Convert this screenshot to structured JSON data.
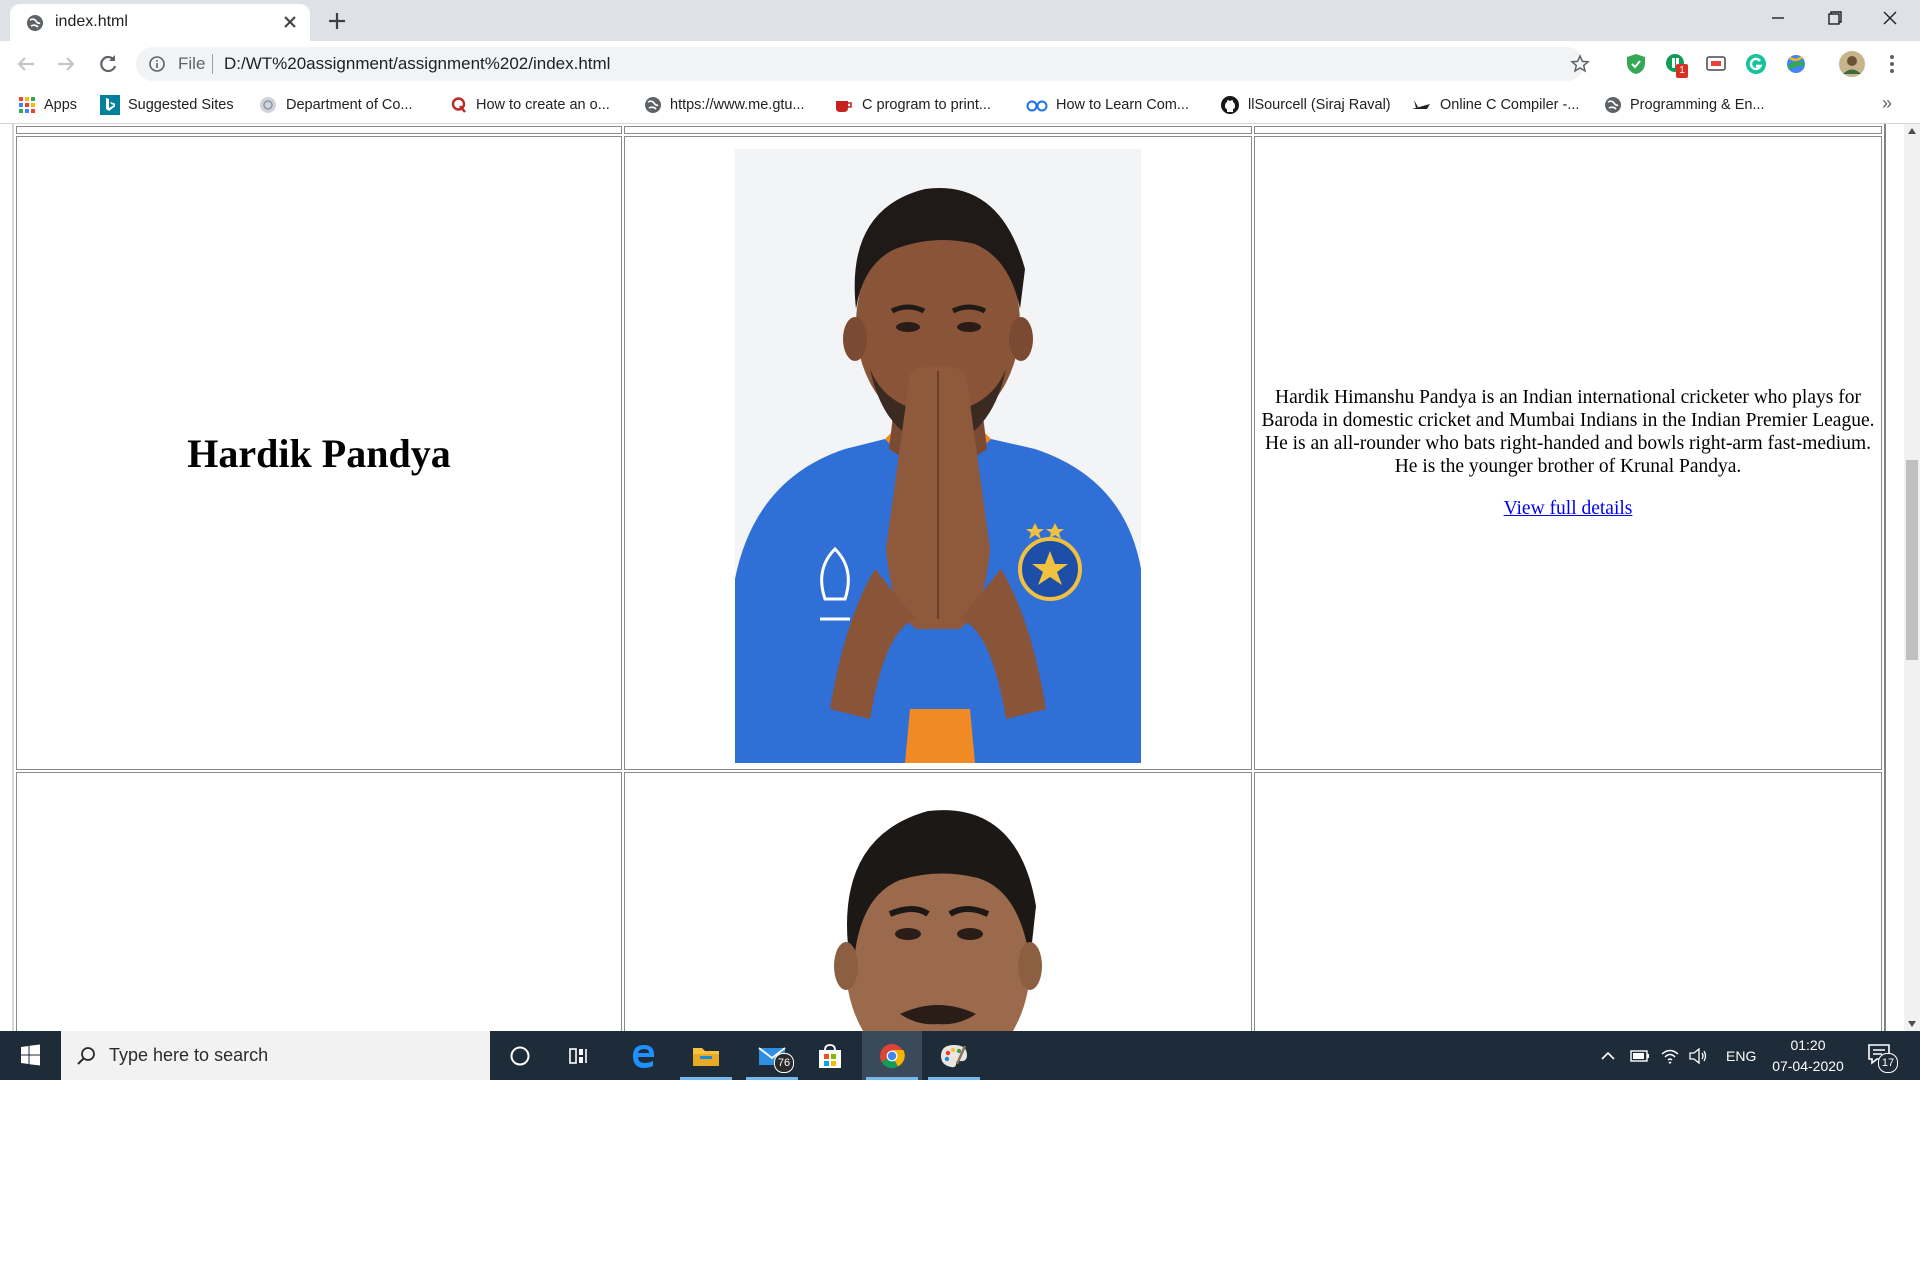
{
  "browser": {
    "tab_title": "index.html",
    "omnibox": {
      "scheme_label": "File",
      "url": "D:/WT%20assignment/assignment%202/index.html"
    },
    "bookmarks": [
      {
        "label": "Apps",
        "icon": "apps-grid-icon"
      },
      {
        "label": "Suggested Sites",
        "icon": "bing-icon"
      },
      {
        "label": "Department of Co...",
        "icon": "globe-icon"
      },
      {
        "label": "How to create an o...",
        "icon": "quora-icon"
      },
      {
        "label": "https://www.me.gtu...",
        "icon": "globe-icon"
      },
      {
        "label": "C program to print...",
        "icon": "coffee-cup-icon"
      },
      {
        "label": "How to Learn Com...",
        "icon": "glasses-icon"
      },
      {
        "label": "llSourcell (Siraj Raval)",
        "icon": "github-icon"
      },
      {
        "label": "Online C Compiler -...",
        "icon": "plane-icon"
      },
      {
        "label": "Programming & En...",
        "icon": "globe-icon"
      }
    ],
    "extensions": {
      "badge_count": "1"
    }
  },
  "page": {
    "rows": [
      {
        "name": "Hardik Pandya",
        "bio": "Hardik Himanshu Pandya is an Indian international cricketer who plays for Baroda in domestic cricket and Mumbai Indians in the Indian Premier League. He is an all-rounder who bats right-handed and bowls right-arm fast-medium. He is the younger brother of Krunal Pandya.",
        "link_text": "View full details"
      }
    ]
  },
  "taskbar": {
    "search_placeholder": "Type here to search",
    "mail_badge": "76",
    "language": "ENG",
    "time": "01:20",
    "date": "07-04-2020",
    "notification_count": "17"
  },
  "colors": {
    "taskbar_bg": "#1e2b38",
    "link": "#0000ee",
    "jersey_blue": "#2f6fd6"
  }
}
